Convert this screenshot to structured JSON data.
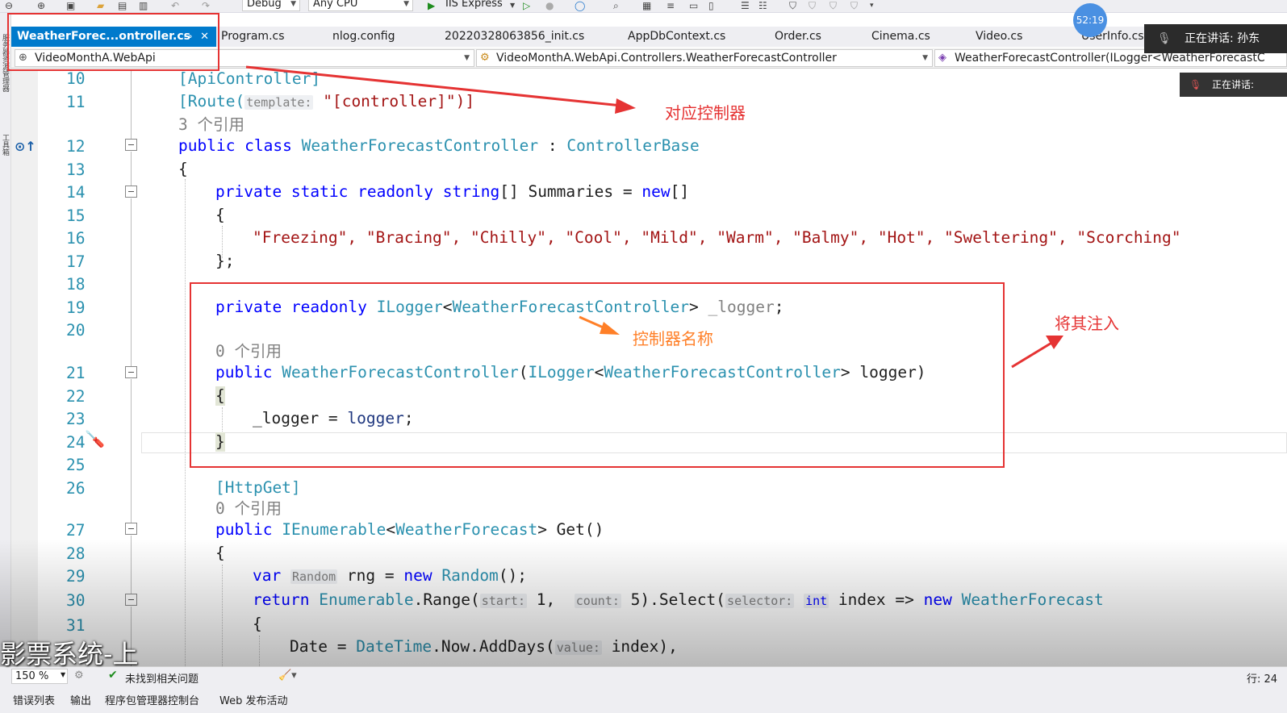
{
  "toolbar": {
    "config": "Debug",
    "platform": "Any CPU",
    "run_target": "IIS Express"
  },
  "tabs": [
    {
      "label": "WeatherForec...ontroller.cs",
      "active": true
    },
    {
      "label": "Program.cs"
    },
    {
      "label": "nlog.config"
    },
    {
      "label": "20220328063856_init.cs"
    },
    {
      "label": "AppDbContext.cs"
    },
    {
      "label": "Order.cs"
    },
    {
      "label": "Cinema.cs"
    },
    {
      "label": "Video.cs"
    },
    {
      "label": "UserInfo.cs"
    }
  ],
  "navbar": {
    "project": "VideoMonthA.WebApi",
    "type": "VideoMonthA.WebApi.Controllers.WeatherForecastController",
    "member": "WeatherForecastController(ILogger<WeatherForecastC"
  },
  "timer": "52:19",
  "meeting": {
    "speaking_main": "正在讲话: 孙东",
    "speaking_small": "正在讲话:"
  },
  "line_numbers": [
    "10",
    "11",
    "12",
    "13",
    "14",
    "15",
    "16",
    "17",
    "18",
    "19",
    "20",
    "21",
    "22",
    "23",
    "24",
    "25",
    "26",
    "27",
    "28",
    "29",
    "30",
    "31"
  ],
  "code": {
    "l10": "[ApiController]",
    "l11_a": "[Route(",
    "l11_hint": "template:",
    "l11_b": "\"[controller]\")]",
    "ref3": "3 个引用",
    "l12_kw": "public class",
    "l12_name": "WeatherForecastController",
    "l12_colon": ":",
    "l12_base": "ControllerBase",
    "brace_open": "{",
    "l14_kw": "private static readonly",
    "l14_type": "string",
    "l14_rest": "[] Summaries =",
    "l14_new": "new",
    "l14_end": "[]",
    "l16": "\"Freezing\", \"Bracing\", \"Chilly\", \"Cool\", \"Mild\", \"Warm\", \"Balmy\", \"Hot\", \"Sweltering\", \"Scorching\"",
    "l17": "};",
    "l19_kw": "private readonly",
    "l19_type": "ILogger",
    "l19_lt": "<",
    "l19_gen": "WeatherForecastController",
    "l19_gt": ">",
    "l19_field": "_logger",
    "l19_semi": ";",
    "ref0": "0 个引用",
    "l21_kw": "public",
    "l21_name": "WeatherForecastController",
    "l21_paren": "(",
    "l21_type": "ILogger",
    "l21_gen": "WeatherForecastController",
    "l21_rest": "> logger)",
    "l23_a": "_logger =",
    "l23_b": "logger",
    "l23_c": ";",
    "brace_close": "}",
    "l26": "[HttpGet]",
    "l27_kw": "public",
    "l27_type": "IEnumerable",
    "l27_gen": "WeatherForecast",
    "l27_rest": "> Get()",
    "l29_var": "var",
    "l29_hint": "Random",
    "l29_a": "rng =",
    "l29_new": "new",
    "l29_type": "Random",
    "l29_end": "();",
    "l30_ret": "return",
    "l30_enum": "Enumerable",
    "l30_range": ".Range(",
    "l30_h1": "start:",
    "l30_v1": "1,",
    "l30_h2": "count:",
    "l30_v2": "5).Select(",
    "l30_h3": "selector:",
    "l30_int": "int",
    "l30_idx": "index =>",
    "l30_new": "new",
    "l30_wf": "WeatherForecast",
    "l32_a": "Date =",
    "l32_dt": "DateTime",
    "l32_b": ".Now.AddDays(",
    "l32_hint": "value:",
    "l32_c": "index),"
  },
  "annotations": {
    "controller": "对应控制器",
    "name": "控制器名称",
    "inject": "将其注入"
  },
  "subtitle": "影票系统-上",
  "status": {
    "zoom": "150 %",
    "issues": "未找到相关问题",
    "position": "行: 24"
  },
  "bottom_tabs": [
    "错误列表",
    "输出",
    "程序包管理器控制台",
    "Web 发布活动"
  ],
  "colors": {
    "accent": "#007acc",
    "annotation_red": "#e53333",
    "annotation_orange": "#ff7f27"
  }
}
